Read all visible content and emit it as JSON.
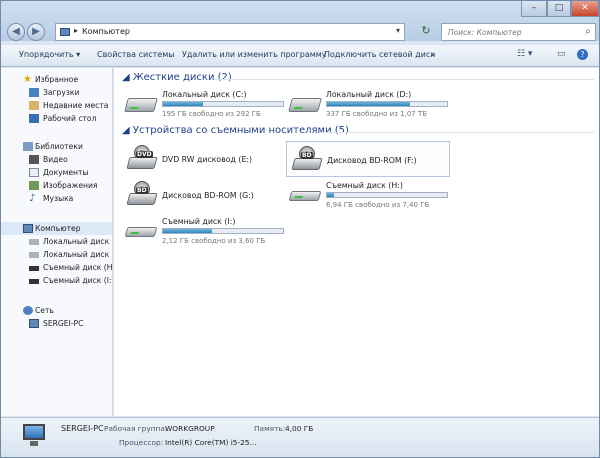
{
  "address": {
    "crumb": "Компьютер",
    "search_placeholder": "Поиск: Компьютер"
  },
  "toolbar": {
    "organize": "Упорядочить",
    "system_props": "Свойства системы",
    "uninstall": "Удалить или изменить программу",
    "map_drive": "Подключить сетевой диск",
    "more": "»"
  },
  "nav": {
    "favorites": "Избранное",
    "downloads": "Загрузки",
    "recent": "Недавние места",
    "desktop": "Рабочий стол",
    "libraries": "Библиотеки",
    "video": "Видео",
    "documents": "Документы",
    "images": "Изображения",
    "music": "Музыка",
    "computer": "Компьютер",
    "disk_c": "Локальный диск (C",
    "disk_d": "Локальный диск (D",
    "removable_h": "Съемный диск (H:)",
    "removable_i": "Съемный диск (I:)",
    "network": "Сеть",
    "pc": "SERGEI-PC"
  },
  "groups": {
    "hdd": "Жесткие диски (2)",
    "removable": "Устройства со съемными носителями (5)"
  },
  "drives": {
    "c": {
      "name": "Локальный диск (C:)",
      "free": "195 ГБ свободно из 292 ГБ",
      "used": 0.33
    },
    "d": {
      "name": "Локальный диск (D:)",
      "free": "337 ГБ свободно из 1,07 ТБ",
      "used": 0.69
    },
    "e": {
      "name": "DVD RW дисковод (E:)",
      "badge": "DVD"
    },
    "f": {
      "name": "Дисковод BD-ROM (F:)",
      "badge": "BD"
    },
    "g": {
      "name": "Дисковод BD-ROM (G:)",
      "badge": "BD"
    },
    "h": {
      "name": "Съемный диск (H:)",
      "free": "6,94 ГБ свободно из 7,40 ГБ",
      "used": 0.06
    },
    "i": {
      "name": "Съемный диск (I:)",
      "free": "2,12 ГБ свободно из 3,60 ГБ",
      "used": 0.41
    }
  },
  "status": {
    "pc_name": "SERGEI-PC",
    "workgroup_label": "Рабочая группа:",
    "workgroup": "WORKGROUP",
    "memory_label": "Память:",
    "memory": "4,00 ГБ",
    "cpu_label": "Процессор:",
    "cpu": "Intel(R) Core(TM) i5-25..."
  },
  "colors": {
    "accent": "#1e3f8a",
    "bar": "#2f86bd"
  }
}
